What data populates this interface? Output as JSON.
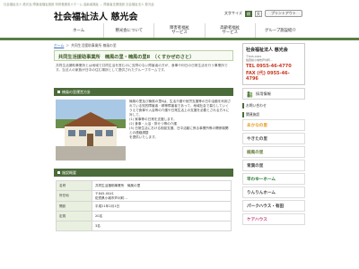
{
  "top_strip": "社会福祉法人 慈光会 障害者福祉施設 特別養護老人ホーム 高齢者福祉 ... 障害者支援施設 社会福祉法人 慈光会",
  "header": {
    "logo": "社会福祉法人 慈光会",
    "font_size_label": "文字サイズ",
    "font_sizes": [
      "標",
      "大"
    ],
    "print_label": "プリントアウト"
  },
  "nav": [
    "ホーム",
    "慈光会について",
    "障害者福祉\nサービス",
    "高齢者福祉\nサービス",
    "グループ施設紹介"
  ],
  "breadcrumb": {
    "home": "ホーム",
    "sep": "＞",
    "current": "共同生活援助事業所 楠風の里"
  },
  "main": {
    "title": "共同生活援助事業所　楠風の里・楠風の里Ⅱ　（くすかぜのさと）",
    "intro": "共同生活援助事業所とは地域で共同生活を営むのに支障のない障害者の方が、食事や何日の日常生活を行う事業所です。当法人の家族が日中の住む場所として提供されたグループホームです。",
    "section1": {
      "heading": "楠風の里運営方針",
      "text": "楠風の里及び楠風の里Ⅱは、生活介護や就労支援等の日中活動を利用されている知的障害者・精神障害者であって、地域社会で暮らしていくうえで食事や入浴等の介護や日常生活上の支援を必要とされる方々に対して、\n(1) 家事等の日常を支援します。\n(2) 食事・入浴・排せつ等の介護\n(3) 日常生活における相談支援、日中活動に係る事業所等の関係機関との連絡調整\nを提供いたします。"
    },
    "section2": {
      "heading": "施設概要",
      "rows": [
        {
          "label": "名称",
          "value": "共同生活援助事業所　楠風の里"
        },
        {
          "label": "所在地",
          "value": "〒845-0041\n佐賀県小城市芦刈町..."
        },
        {
          "label": "開設",
          "value": "平成21年2月1日"
        },
        {
          "label": "定員",
          "value": "20名"
        },
        {
          "label": "",
          "value": "3名"
        }
      ]
    }
  },
  "side": {
    "org": "社会福祉法人 慈光会",
    "addr": "〒845-0041\n佐賀県小城市芦刈町...",
    "tel": "TEL 0955-46-4770",
    "fax": "FAX (代) 0955-46-4796",
    "recruit": "採用情報",
    "links": [
      "お問い合わせ",
      "関連施設"
    ],
    "facilities": [
      "あかなの里",
      "やきたの里",
      "楠風の里",
      "青葉の里",
      "早わゆーホーム",
      "りんりんホーム",
      "パークハウス・有田",
      "ケアハウス"
    ]
  }
}
